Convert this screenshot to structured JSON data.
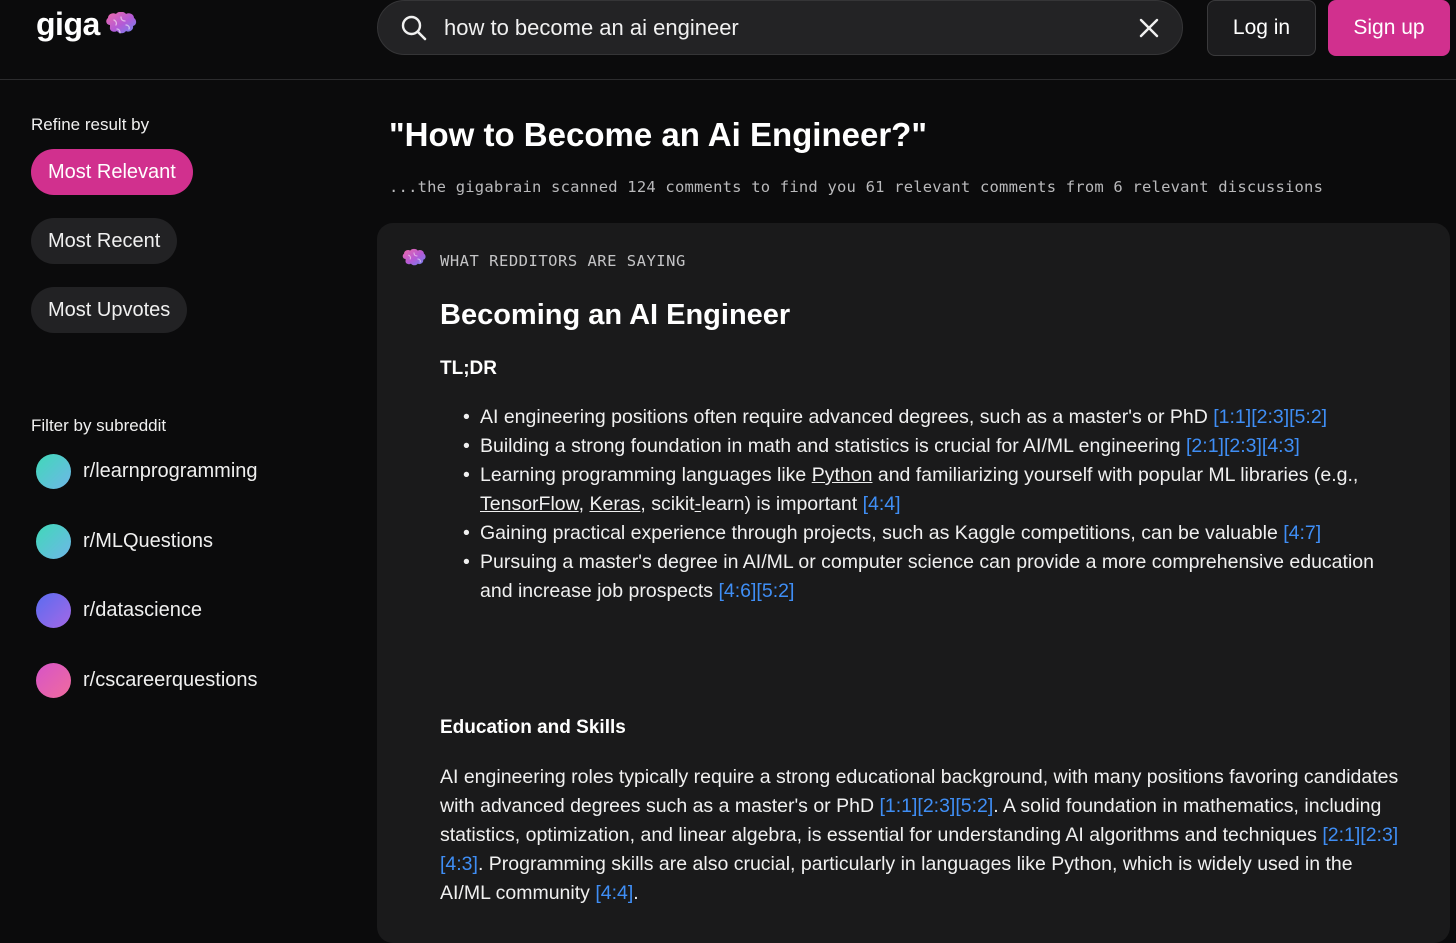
{
  "header": {
    "logo_text": "giga",
    "search_value": "how to become an ai engineer",
    "login_label": "Log in",
    "signup_label": "Sign up"
  },
  "sidebar": {
    "refine_heading": "Refine result by",
    "sort_options": [
      {
        "label": "Most Relevant",
        "active": true
      },
      {
        "label": "Most Recent",
        "active": false
      },
      {
        "label": "Most Upvotes",
        "active": false
      }
    ],
    "filter_heading": "Filter by subreddit",
    "subreddits": [
      {
        "label": "r/learnprogramming",
        "color_from": "#3fd9b8",
        "color_to": "#6fb6e8"
      },
      {
        "label": "r/MLQuestions",
        "color_from": "#3fd9b8",
        "color_to": "#6fb6e8"
      },
      {
        "label": "r/datascience",
        "color_from": "#5a6cf0",
        "color_to": "#a468e6"
      },
      {
        "label": "r/cscareerquestions",
        "color_from": "#d654c8",
        "color_to": "#f06b9e"
      }
    ]
  },
  "main": {
    "title": "\"How to Become an Ai Engineer?\"",
    "scan_summary": "...the gigabrain scanned 124 comments to find you 61 relevant comments from 6 relevant discussions",
    "card": {
      "label": "WHAT REDDITORS ARE SAYING",
      "title": "Becoming an AI Engineer",
      "tldr_heading": "TL;DR",
      "bullets": {
        "b1_text": "AI engineering positions often require advanced degrees, such as a master's or PhD",
        "b1_ref": "[1:1][2:3][5:2]",
        "b2_text": "Building a strong foundation in math and statistics is crucial for AI/ML engineering",
        "b2_ref": "[2:1][2:3][4:3]",
        "b3_pre": "Learning programming languages like",
        "b3_link1": "Python",
        "b3_mid1": "and familiarizing yourself with popular ML libraries (e.g.,",
        "b3_link2": "TensorFlow",
        "b3_comma": ",",
        "b3_link3": "Keras",
        "b3_mid2": ", scikit",
        "b3_dash": "-",
        "b3_post": "learn) is important",
        "b3_ref": "[4:4]",
        "b4_text": "Gaining practical experience through projects, such as Kaggle competitions, can be valuable",
        "b4_ref": "[4:7]",
        "b5_text": "Pursuing a master's degree in AI/ML or computer science can provide a more comprehensive education and increase job prospects",
        "b5_ref": "[4:6][5:2]"
      },
      "edu_heading": "Education and Skills",
      "para": {
        "p1": "AI engineering roles typically require a strong educational background, with many positions favoring candidates with advanced degrees such as a master's or PhD",
        "r1": "[1:1][2:3][5:2]",
        "p2": ". A solid foundation in mathematics, including statistics, optimization, and linear algebra, is essential for understanding AI algorithms and techniques",
        "r2": "[2:1][2:3][4:3]",
        "p3": ". Programming skills are also crucial, particularly in languages like Python, which is widely used in the AI/ML community",
        "r3": "[4:4]",
        "p4": "."
      }
    }
  },
  "colors": {
    "accent": "#d1308e",
    "link": "#3f8ef5",
    "background": "#0b0b0c",
    "card": "#1a1a1b"
  },
  "icons": [
    "brain-icon",
    "search-icon",
    "close-icon"
  ]
}
